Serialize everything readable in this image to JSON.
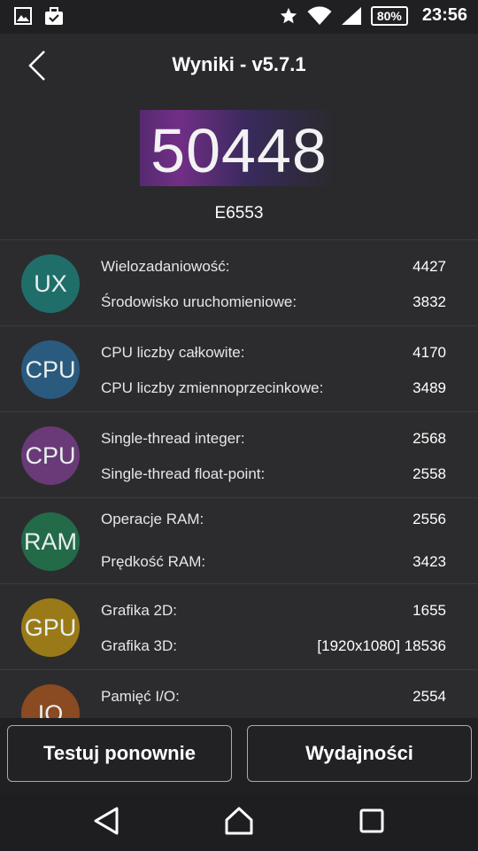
{
  "status_bar": {
    "time": "23:56",
    "battery": "80%",
    "icons": [
      "image-icon",
      "briefcase-icon",
      "star-icon",
      "wifi-icon",
      "signal-icon",
      "battery-icon"
    ]
  },
  "header": {
    "title": "Wyniki - v5.7.1",
    "score": "50448",
    "device": "E6553"
  },
  "groups": [
    {
      "badge": "UX",
      "color": "#1f6e6a",
      "rows": [
        {
          "label": "Wielozadaniowość:",
          "value": "4427"
        },
        {
          "label": "Środowisko uruchomieniowe:",
          "value": "3832"
        }
      ]
    },
    {
      "badge": "CPU",
      "color": "#2a5a7e",
      "rows": [
        {
          "label": "CPU liczby całkowite:",
          "value": "4170"
        },
        {
          "label": "CPU liczby zmiennoprzecinkowe:",
          "value": "3489"
        }
      ]
    },
    {
      "badge": "CPU",
      "color": "#6a3a78",
      "rows": [
        {
          "label": "Single-thread integer:",
          "value": "2568"
        },
        {
          "label": "Single-thread float-point:",
          "value": "2558"
        }
      ]
    },
    {
      "badge": "RAM",
      "color": "#236a48",
      "rows": [
        {
          "label": "Operacje RAM:",
          "value": "2556"
        },
        {
          "label": "Prędkość RAM:",
          "value": "3423"
        }
      ]
    },
    {
      "badge": "GPU",
      "color": "#9a7a18",
      "rows": [
        {
          "label": "Grafika 2D:",
          "value": "1655"
        },
        {
          "label": "Grafika 3D:",
          "value": "[1920x1080] 18536"
        }
      ]
    },
    {
      "badge": "IO",
      "color": "#8a4a22",
      "rows": [
        {
          "label": "Pamięć I/O:",
          "value": "2554"
        }
      ]
    }
  ],
  "buttons": {
    "retest": "Testuj ponownie",
    "performance": "Wydajności"
  }
}
